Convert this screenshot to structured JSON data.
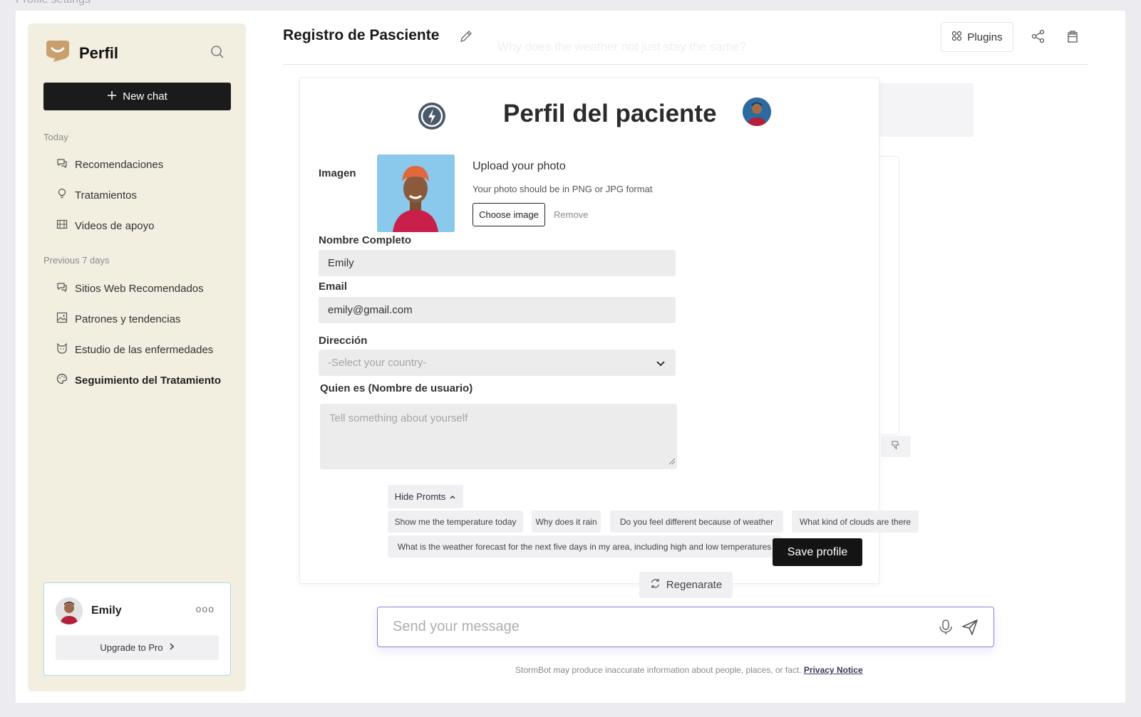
{
  "screen_label": "Profile settings",
  "sidebar": {
    "brand": "Perfil",
    "new_chat": "New chat",
    "today_label": "Today",
    "today_items": [
      {
        "label": "Recomendaciones",
        "icon": "chat-icon"
      },
      {
        "label": "Tratamientos",
        "icon": "lightbulb-icon"
      },
      {
        "label": "Videos de apoyo",
        "icon": "film-icon"
      }
    ],
    "prev_label": "Previous 7 days",
    "prev_items": [
      {
        "label": "Sitios Web Recomendados",
        "icon": "chat-icon"
      },
      {
        "label": "Patrones y tendencias",
        "icon": "image-icon"
      },
      {
        "label": "Estudio de las enfermedades",
        "icon": "cat-icon"
      },
      {
        "label": "Seguimiento del Tratamiento",
        "icon": "palette-icon"
      }
    ],
    "user": {
      "name": "Emily",
      "more": "ooo",
      "upgrade": "Upgrade to Pro"
    }
  },
  "header": {
    "title": "Registro de Pasciente",
    "ghost_text": "Why does the weather not just stay the same?",
    "plugins": "Plugins"
  },
  "profile": {
    "title": "Perfil del paciente",
    "image_label": "Imagen",
    "upload_title": "Upload your photo",
    "upload_sub": "Your photo should be in PNG or JPG format",
    "choose": "Choose image",
    "remove": "Remove",
    "name_label": "Nombre Completo",
    "name_value": "Emily",
    "email_label": "Email",
    "email_value": "emily@gmail.com",
    "address_label": "Dirección",
    "address_placeholder": "-Select your country-",
    "about_label": "Quien es (Nombre de usuario)",
    "about_placeholder": "Tell something about yourself",
    "save": "Save profile"
  },
  "prompts": {
    "hide": "Hide Promts",
    "items": [
      "Show me the temperature today",
      "Why does it rain",
      "Do you feel different because of weather",
      "What kind of clouds are there",
      "What is the weather forecast for the next five days in my area, including high and low temperatures"
    ]
  },
  "regenerate": "Regenarate",
  "composer": {
    "placeholder": "Send your message"
  },
  "footer": {
    "disclaimer": "StormBot may produce inaccurate information about people, places, or fact.",
    "link": "Privacy Notice"
  },
  "colors": {
    "accent": "#8b80d0",
    "sidebar_bg": "#f2efe1",
    "dark_button": "#1b1b1b",
    "card_border": "#a6dbe6"
  }
}
